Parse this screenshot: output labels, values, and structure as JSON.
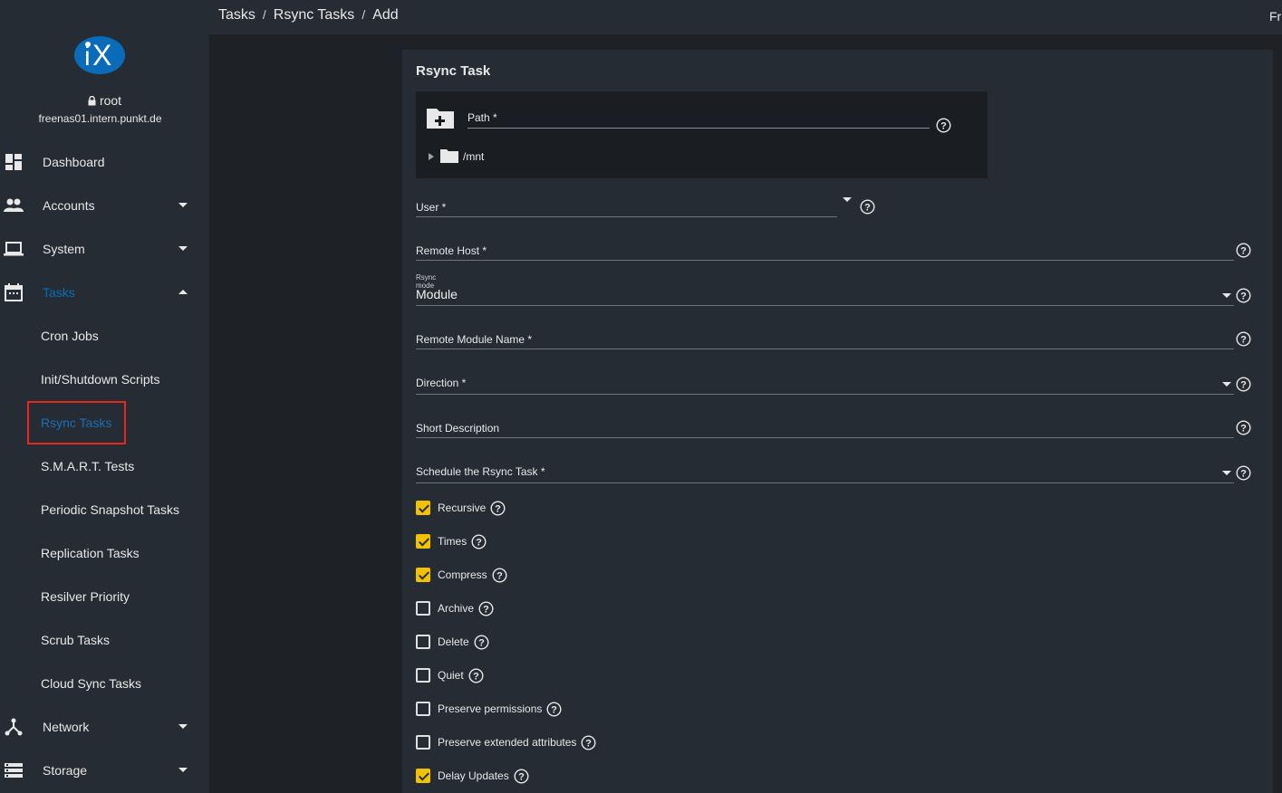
{
  "topbar": {
    "breadcrumb": [
      "Tasks",
      "Rsync Tasks",
      "Add"
    ],
    "separator": "/",
    "right_text": "Fr"
  },
  "sidebar": {
    "logo_text": "iX",
    "user": "root",
    "hostname": "freenas01.intern.punkt.de",
    "nav": [
      {
        "label": "Dashboard",
        "icon": "dashboard-icon"
      },
      {
        "label": "Accounts",
        "icon": "people-icon"
      },
      {
        "label": "System",
        "icon": "laptop-icon"
      },
      {
        "label": "Tasks",
        "icon": "calendar-icon",
        "active": true
      },
      {
        "label": "Network",
        "icon": "network-icon"
      },
      {
        "label": "Storage",
        "icon": "storage-icon"
      }
    ],
    "tasks_sub": [
      "Cron Jobs",
      "Init/Shutdown Scripts",
      "Rsync Tasks",
      "S.M.A.R.T. Tests",
      "Periodic Snapshot Tasks",
      "Replication Tasks",
      "Resilver Priority",
      "Scrub Tasks",
      "Cloud Sync Tasks"
    ],
    "active_sub": "Rsync Tasks"
  },
  "form": {
    "title": "Rsync Task",
    "path_label": "Path *",
    "tree_root": "/mnt",
    "user_label": "User *",
    "remote_host_label": "Remote Host *",
    "rsync_mode_label": "Rsync mode",
    "rsync_mode_value": "Module",
    "remote_module_label": "Remote Module Name *",
    "direction_label": "Direction *",
    "short_description_label": "Short Description",
    "schedule_label": "Schedule the Rsync Task *",
    "checkboxes": [
      {
        "label": "Recursive",
        "checked": true
      },
      {
        "label": "Times",
        "checked": true
      },
      {
        "label": "Compress",
        "checked": true
      },
      {
        "label": "Archive",
        "checked": false
      },
      {
        "label": "Delete",
        "checked": false
      },
      {
        "label": "Quiet",
        "checked": false
      },
      {
        "label": "Preserve permissions",
        "checked": false
      },
      {
        "label": "Preserve extended attributes",
        "checked": false
      },
      {
        "label": "Delay Updates",
        "checked": true
      }
    ]
  },
  "colors": {
    "accent_blue": "#0a6cb8",
    "checkbox_yellow": "#f2c200",
    "highlight_red": "#e8281e"
  }
}
